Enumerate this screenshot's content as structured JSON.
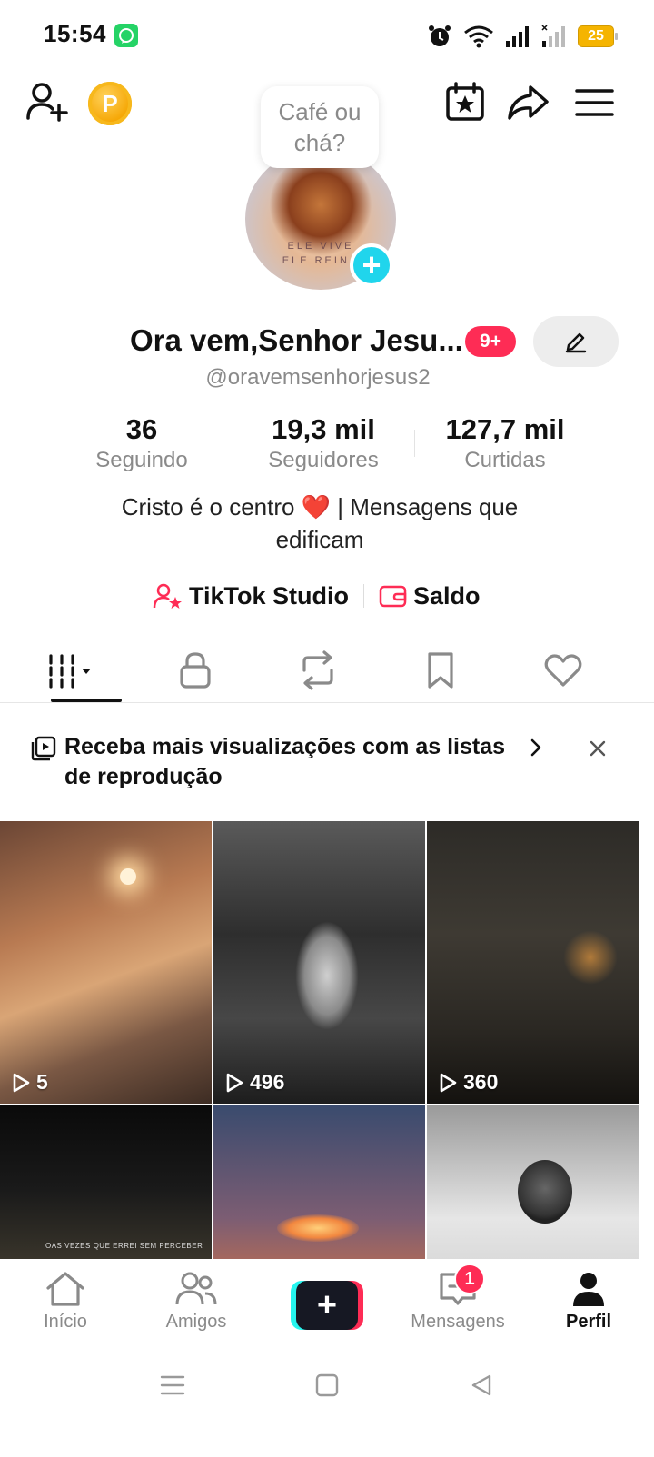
{
  "status_bar": {
    "time": "15:54",
    "battery": "25",
    "icons": [
      "whatsapp-icon",
      "alarm-icon",
      "wifi-icon",
      "signal-icon",
      "signal-icon-2",
      "battery-icon"
    ]
  },
  "top_bar": {
    "coin_label": "P",
    "icons": [
      "add-friend-icon",
      "coin-icon",
      "calendar-star-icon",
      "share-icon",
      "menu-icon"
    ]
  },
  "bubble": {
    "text": "Café ou chá?"
  },
  "profile": {
    "name": "Ora vem,Senhor Jesu...",
    "notif_badge": "9+",
    "username": "@oravemsenhorjesus2",
    "avatar_caption_line1": "ELE VIVE",
    "avatar_caption_line2": "ELE REINA",
    "bio": "Cristo é o centro ❤️ | Mensagens que edificam"
  },
  "stats": [
    {
      "value": "36",
      "label": "Seguindo"
    },
    {
      "value": "19,3 mil",
      "label": "Seguidores"
    },
    {
      "value": "127,7 mil",
      "label": "Curtidas"
    }
  ],
  "links": {
    "studio": "TikTok Studio",
    "balance": "Saldo"
  },
  "tabs": [
    "videos-grid-tab",
    "private-tab",
    "reposts-tab",
    "favorites-tab",
    "liked-tab"
  ],
  "banner": {
    "text": "Receba mais visualizações com as listas de reprodução"
  },
  "videos": [
    {
      "views": "5"
    },
    {
      "views": "496"
    },
    {
      "views": "360"
    },
    {
      "views": "",
      "caption": "OAS VEZES QUE ERREI SEM PERCEBER"
    },
    {
      "views": ""
    },
    {
      "views": ""
    }
  ],
  "bottom_nav": {
    "home": "Início",
    "friends": "Amigos",
    "create": "+",
    "messages": "Mensagens",
    "messages_badge": "1",
    "profile": "Perfil"
  },
  "colors": {
    "accent": "#fe2c55",
    "cyan": "#20d5ec",
    "text_secondary": "#8a8a8a"
  }
}
